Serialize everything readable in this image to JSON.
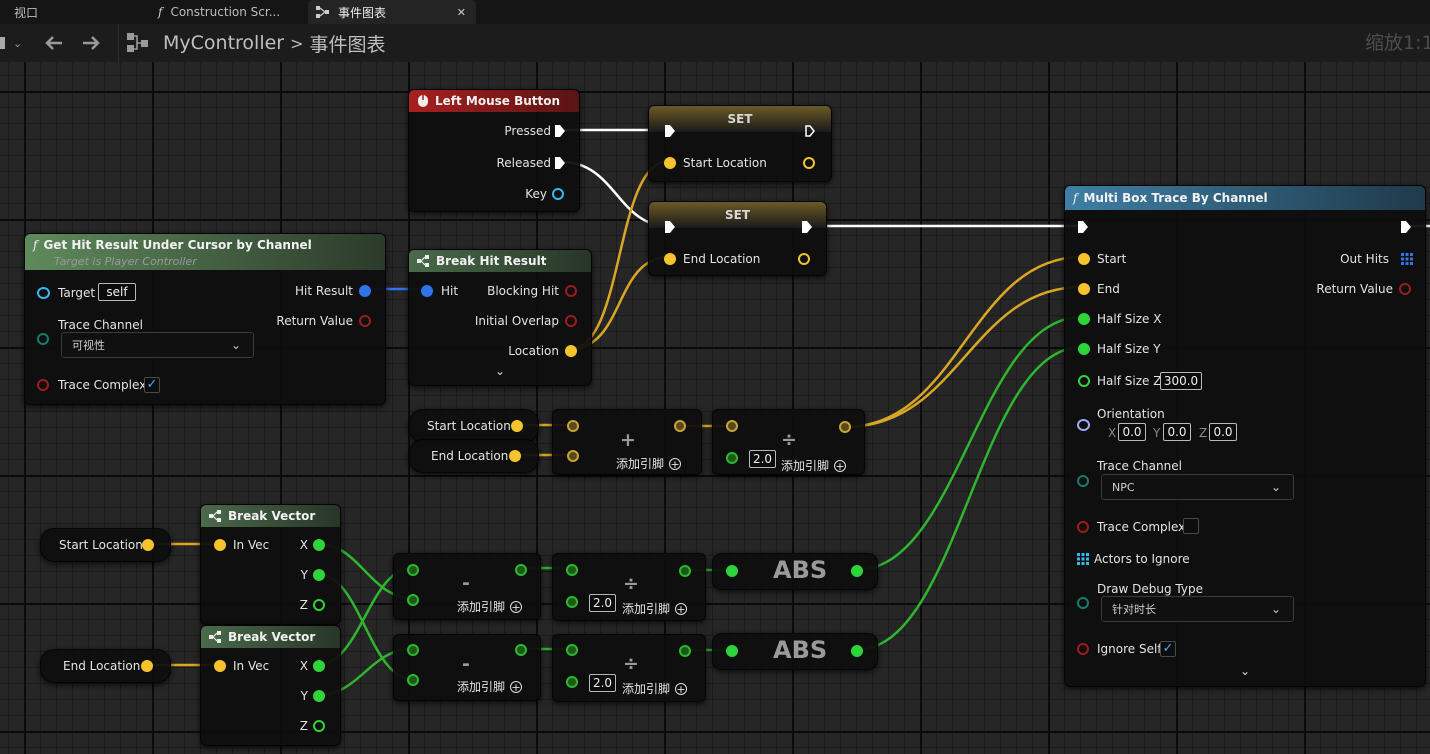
{
  "tabs": [
    {
      "label": "视口"
    },
    {
      "label": "Construction Scr..."
    },
    {
      "label": "事件图表",
      "close": "✕"
    }
  ],
  "breadcrumb": {
    "root": "MyController",
    "separator": ">",
    "current": "事件图表"
  },
  "zoom": "缩放1:1",
  "nodes": {
    "lmb": {
      "title": "Left Mouse Button",
      "pressed": "Pressed",
      "released": "Released",
      "key": "Key"
    },
    "set1": {
      "title": "SET",
      "var": "Start Location"
    },
    "set2": {
      "title": "SET",
      "var": "End Location"
    },
    "hit": {
      "title": "Get Hit Result Under Cursor by Channel",
      "subtitle": "Target is Player Controller",
      "target": "Target",
      "target_value": "self",
      "trace_channel": "Trace Channel",
      "trace_channel_value": "可视性",
      "trace_complex": "Trace Complex",
      "hit_result": "Hit Result",
      "return_value": "Return Value"
    },
    "bhr": {
      "title": "Break Hit Result",
      "hit": "Hit",
      "blocking_hit": "Blocking Hit",
      "initial_overlap": "Initial Overlap",
      "location": "Location"
    },
    "var_start1": {
      "label": "Start Location"
    },
    "var_end1": {
      "label": "End Location"
    },
    "add": {
      "op": "+",
      "add_pin": "添加引脚"
    },
    "div1": {
      "op": "÷",
      "value": "2.0",
      "add_pin": "添加引脚"
    },
    "var_start2": {
      "label": "Start Location"
    },
    "var_end2": {
      "label": "End Location"
    },
    "bv1": {
      "title": "Break Vector",
      "in": "In Vec",
      "x": "X",
      "y": "Y",
      "z": "Z"
    },
    "bv2": {
      "title": "Break Vector",
      "in": "In Vec",
      "x": "X",
      "y": "Y",
      "z": "Z"
    },
    "sub1": {
      "op": "-",
      "add_pin": "添加引脚"
    },
    "sub2": {
      "op": "-",
      "add_pin": "添加引脚"
    },
    "div2": {
      "op": "÷",
      "value": "2.0",
      "add_pin": "添加引脚"
    },
    "div3": {
      "op": "÷",
      "value": "2.0",
      "add_pin": "添加引脚"
    },
    "abs1": {
      "label": "ABS"
    },
    "abs2": {
      "label": "ABS"
    },
    "mbt": {
      "title": "Multi Box Trace By Channel",
      "start": "Start",
      "end": "End",
      "half_x": "Half Size X",
      "half_y": "Half Size Y",
      "half_z": "Half Size Z",
      "half_z_value": "300.0",
      "orientation": "Orientation",
      "ox": "X",
      "oy": "Y",
      "oz": "Z",
      "ox_value": "0.0",
      "oy_value": "0.0",
      "oz_value": "0.0",
      "trace_channel": "Trace Channel",
      "trace_channel_value": "NPC",
      "trace_complex": "Trace Complex",
      "actors_to_ignore": "Actors to Ignore",
      "draw_debug": "Draw Debug Type",
      "draw_debug_value": "针对时长",
      "ignore_self": "Ignore Self",
      "out_hits": "Out Hits",
      "return_value": "Return Value"
    }
  },
  "colors": {
    "exec": "#ffffff",
    "vector": "#f5c32b",
    "float": "#2fd33a",
    "struct": "#2f74e8",
    "object": "#36b8ef",
    "bool": "#9c1b1b",
    "byte": "#1a7a6a"
  }
}
